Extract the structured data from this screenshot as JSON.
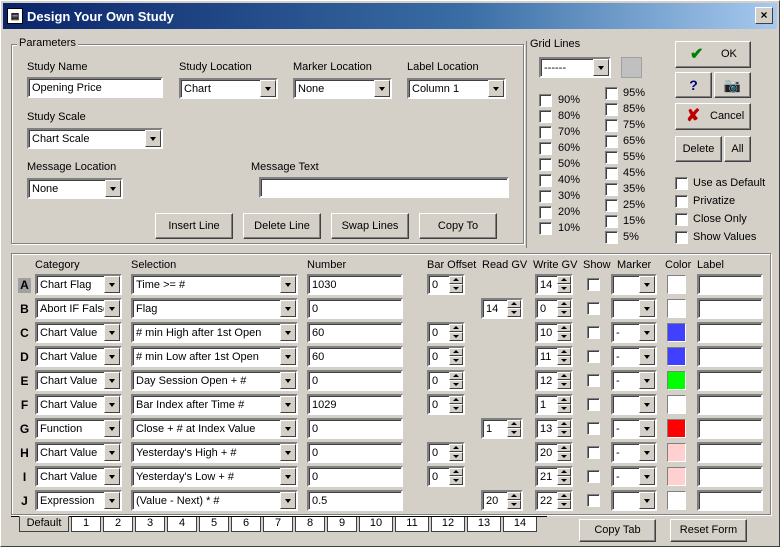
{
  "window": {
    "title": "Design Your Own Study",
    "close": "×"
  },
  "parameters": {
    "group_label": "Parameters",
    "study_name": {
      "label": "Study Name",
      "value": "Opening Price"
    },
    "study_location": {
      "label": "Study Location",
      "value": "Chart"
    },
    "marker_location": {
      "label": "Marker Location",
      "value": "None"
    },
    "label_location": {
      "label": "Label Location",
      "value": "Column 1"
    },
    "study_scale": {
      "label": "Study Scale",
      "value": "Chart Scale"
    },
    "message_location": {
      "label": "Message Location",
      "value": "None"
    },
    "message_text": {
      "label": "Message Text",
      "value": ""
    },
    "buttons": {
      "insert_line": "Insert Line",
      "delete_line": "Delete Line",
      "swap_lines": "Swap Lines",
      "copy_to": "Copy To"
    }
  },
  "grid_lines": {
    "label": "Grid Lines",
    "style_value": "------",
    "left": [
      "90%",
      "80%",
      "70%",
      "60%",
      "50%",
      "40%",
      "30%",
      "20%",
      "10%"
    ],
    "right": [
      "95%",
      "85%",
      "75%",
      "65%",
      "55%",
      "45%",
      "35%",
      "25%",
      "15%",
      "5%"
    ]
  },
  "side": {
    "ok": "OK",
    "help": "?",
    "cancel": "Cancel",
    "delete": "Delete",
    "all": "All",
    "use_as_default": "Use as Default",
    "privatize": "Privatize",
    "close_only": "Close Only",
    "show_values": "Show Values"
  },
  "columns": {
    "category": "Category",
    "selection": "Selection",
    "number": "Number",
    "bar_offset": "Bar Offset",
    "read_gv": "Read GV",
    "write_gv": "Write GV",
    "show": "Show",
    "marker": "Marker",
    "color": "Color",
    "label": "Label"
  },
  "rows": [
    {
      "letter": "A",
      "category": "Chart Flag",
      "selection": "Time >= #",
      "number": "1030",
      "bar_offset": "0",
      "read_gv": "",
      "write_gv": "14",
      "marker": "",
      "color": "#ffffff"
    },
    {
      "letter": "B",
      "category": "Abort IF False",
      "selection": "Flag",
      "number": "0",
      "bar_offset": "",
      "read_gv": "14",
      "write_gv": "0",
      "marker": "",
      "color": "#ffffff"
    },
    {
      "letter": "C",
      "category": "Chart Value",
      "selection": "# min High after 1st Open",
      "number": "60",
      "bar_offset": "0",
      "read_gv": "",
      "write_gv": "10",
      "marker": "-",
      "color": "#4040ff"
    },
    {
      "letter": "D",
      "category": "Chart Value",
      "selection": "# min Low  after 1st Open",
      "number": "60",
      "bar_offset": "0",
      "read_gv": "",
      "write_gv": "11",
      "marker": "-",
      "color": "#4040ff"
    },
    {
      "letter": "E",
      "category": "Chart Value",
      "selection": "Day Session Open + #",
      "number": "0",
      "bar_offset": "0",
      "read_gv": "",
      "write_gv": "12",
      "marker": "-",
      "color": "#00ff00"
    },
    {
      "letter": "F",
      "category": "Chart Value",
      "selection": "Bar Index after Time #",
      "number": "1029",
      "bar_offset": "0",
      "read_gv": "",
      "write_gv": "1",
      "marker": "",
      "color": "#ffffff"
    },
    {
      "letter": "G",
      "category": "Function",
      "selection": "Close + # at Index Value",
      "number": "0",
      "bar_offset": "",
      "read_gv": "1",
      "write_gv": "13",
      "marker": "-",
      "color": "#ff0000"
    },
    {
      "letter": "H",
      "category": "Chart Value",
      "selection": "Yesterday's High  + #",
      "number": "0",
      "bar_offset": "0",
      "read_gv": "",
      "write_gv": "20",
      "marker": "-",
      "color": "#ffd0d0"
    },
    {
      "letter": "I",
      "category": "Chart Value",
      "selection": "Yesterday's Low   + #",
      "number": "0",
      "bar_offset": "0",
      "read_gv": "",
      "write_gv": "21",
      "marker": "-",
      "color": "#ffd0d0"
    },
    {
      "letter": "J",
      "category": "Expression",
      "selection": "(Value - Next) * #",
      "number": "0.5",
      "bar_offset": "",
      "read_gv": "20",
      "write_gv": "22",
      "marker": "",
      "color": "#ffffff"
    }
  ],
  "tabs": [
    "Default",
    "1",
    "2",
    "3",
    "4",
    "5",
    "6",
    "7",
    "8",
    "9",
    "10",
    "11",
    "12",
    "13",
    "14"
  ],
  "bottom": {
    "copy_tab": "Copy Tab",
    "reset_form": "Reset Form"
  }
}
